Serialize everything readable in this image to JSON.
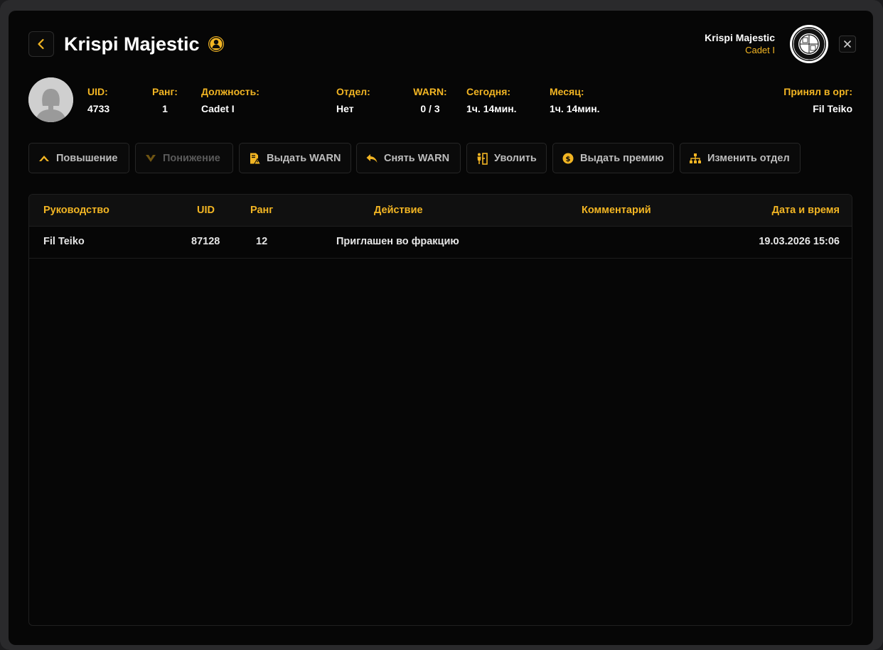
{
  "header": {
    "title": "Krispi Majestic",
    "user_name": "Krispi Majestic",
    "user_rank": "Cadet I"
  },
  "profile": {
    "uid_label": "UID:",
    "uid": "4733",
    "rank_label": "Ранг:",
    "rank": "1",
    "position_label": "Должность:",
    "position": "Cadet I",
    "department_label": "Отдел:",
    "department": "Нет",
    "warn_label": "WARN:",
    "warn": "0 / 3",
    "today_label": "Сегодня:",
    "today": "1ч. 14мин.",
    "month_label": "Месяц:",
    "month": "1ч. 14мин.",
    "accepted_label": "Принял в орг:",
    "accepted_by": "Fil Teiko"
  },
  "actions": [
    {
      "label": "Повышение",
      "icon": "chevron-up-icon",
      "enabled": true
    },
    {
      "label": "Понижение",
      "icon": "chevron-down-icon",
      "enabled": false
    },
    {
      "label": "Выдать WARN",
      "icon": "warn-document-icon",
      "enabled": true
    },
    {
      "label": "Снять WARN",
      "icon": "reply-icon",
      "enabled": true
    },
    {
      "label": "Уволить",
      "icon": "fire-user-icon",
      "enabled": true
    },
    {
      "label": "Выдать премию",
      "icon": "coin-icon",
      "enabled": true
    },
    {
      "label": "Изменить отдел",
      "icon": "hierarchy-icon",
      "enabled": true
    }
  ],
  "table": {
    "columns": [
      "Руководство",
      "UID",
      "Ранг",
      "Действие",
      "Комментарий",
      "Дата и время"
    ],
    "rows": [
      {
        "manager": "Fil Teiko",
        "uid": "87128",
        "rank": "12",
        "action": "Приглашен во фракцию",
        "comment": "",
        "datetime": "19.03.2026 15:06"
      }
    ]
  },
  "colors": {
    "accent": "#f2b523",
    "background": "#060606"
  }
}
